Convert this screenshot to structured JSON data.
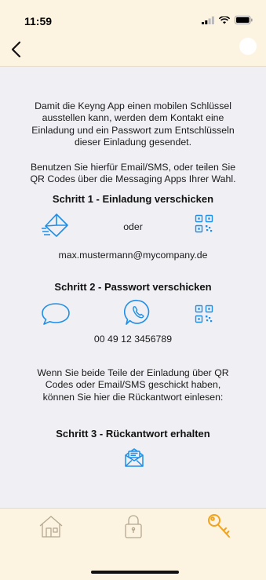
{
  "status": {
    "time": "11:59"
  },
  "colors": {
    "accent_blue": "#1d8fe8",
    "accent_orange": "#f3a31a",
    "bar_bg": "#fdf3e1",
    "icon_grey": "#b4a98f"
  },
  "intro": {
    "line1": "Damit die Keyng App einen mobilen Schlüssel",
    "line2": "ausstellen kann, werden dem Kontakt eine",
    "line3": "Einladung und ein Passwort zum Entschlüsseln",
    "line4": "dieser Einladung gesendet."
  },
  "intro2": {
    "line1": "Benutzen Sie hierfür Email/SMS, oder teilen Sie",
    "line2": "QR Codes über die Messaging Apps Ihrer Wahl."
  },
  "step1": {
    "title": "Schritt 1 - Einladung verschicken",
    "or_label": "oder",
    "email": "max.mustermann@mycompany.de",
    "icons": [
      "envelope-send-icon",
      "qr-code-icon"
    ]
  },
  "step2": {
    "title": "Schritt 2 - Passwort verschicken",
    "phone": "00 49 12 3456789",
    "icons": [
      "sms-bubble-icon",
      "whatsapp-icon",
      "qr-code-icon"
    ]
  },
  "step3_intro": {
    "line1": "Wenn Sie beide Teile der Einladung über QR",
    "line2": "Codes oder Email/SMS geschickt haben,",
    "line3": "können Sie hier die Rückantwort einlesen:"
  },
  "step3": {
    "title": "Schritt 3 - Rückantwort erhalten",
    "icons": [
      "envelope-read-icon"
    ]
  },
  "tabbar": {
    "items": [
      {
        "icon": "home-icon",
        "active": false
      },
      {
        "icon": "lock-icon",
        "active": false
      },
      {
        "icon": "key-icon",
        "active": true
      }
    ]
  }
}
